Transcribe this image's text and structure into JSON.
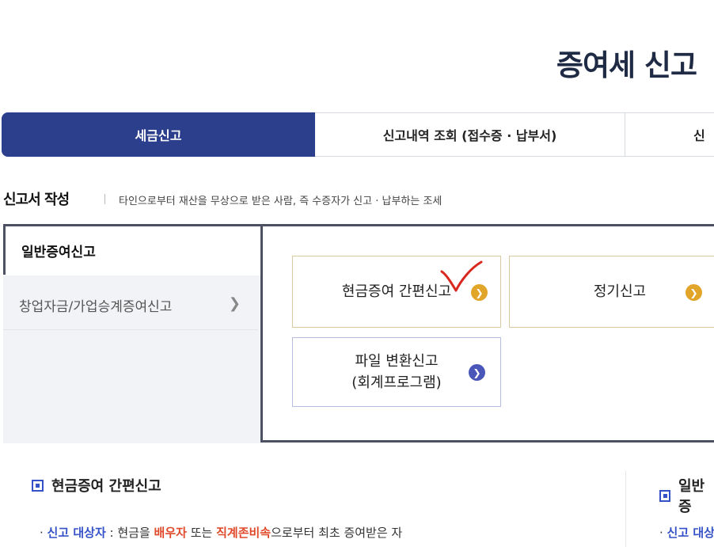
{
  "page": {
    "title": "증여세 신고"
  },
  "tabs": [
    {
      "label": "세금신고",
      "active": true
    },
    {
      "label": "신고내역 조회 (접수증 · 납부서)",
      "active": false
    },
    {
      "label": "신",
      "active": false
    }
  ],
  "section": {
    "title": "신고서 작성",
    "description": "타인으로부터 재산을 무상으로 받은 사람, 즉 수증자가 신고 · 납부하는 조세"
  },
  "menu": {
    "items": [
      {
        "label": "일반증여신고",
        "selected": true
      },
      {
        "label": "창업자금/가업승계증여신고",
        "selected": false
      }
    ]
  },
  "options": {
    "cash_simple": "현금증여 간편신고",
    "regular": "정기신고",
    "file_line1": "파일 변환신고",
    "file_line2": "(회계프로그램)"
  },
  "info": {
    "left_title": "현금증여 간편신고",
    "right_title": "일반증",
    "left_prefix": "· ",
    "left_label": "신고 대상자",
    "left_colon": " : 현금을 ",
    "left_spouse": "배우자",
    "left_or": " 또는 ",
    "left_lineal": "직계존비속",
    "left_rest": "으로부터 최초 증여받은 자",
    "right_prefix": "· ",
    "right_label": "신고 대상"
  },
  "colors": {
    "tab_active": "#2c3f8c",
    "accent_gold": "#e1a529",
    "accent_blue": "#4a56b8",
    "highlight_red": "#e04a2b",
    "check_mark": "#d9281f"
  },
  "icons": {
    "chevron": "chevron-right-icon",
    "arrow": "arrow-right-circle-icon",
    "check": "check-mark-icon",
    "bullet": "square-bullet-icon"
  }
}
